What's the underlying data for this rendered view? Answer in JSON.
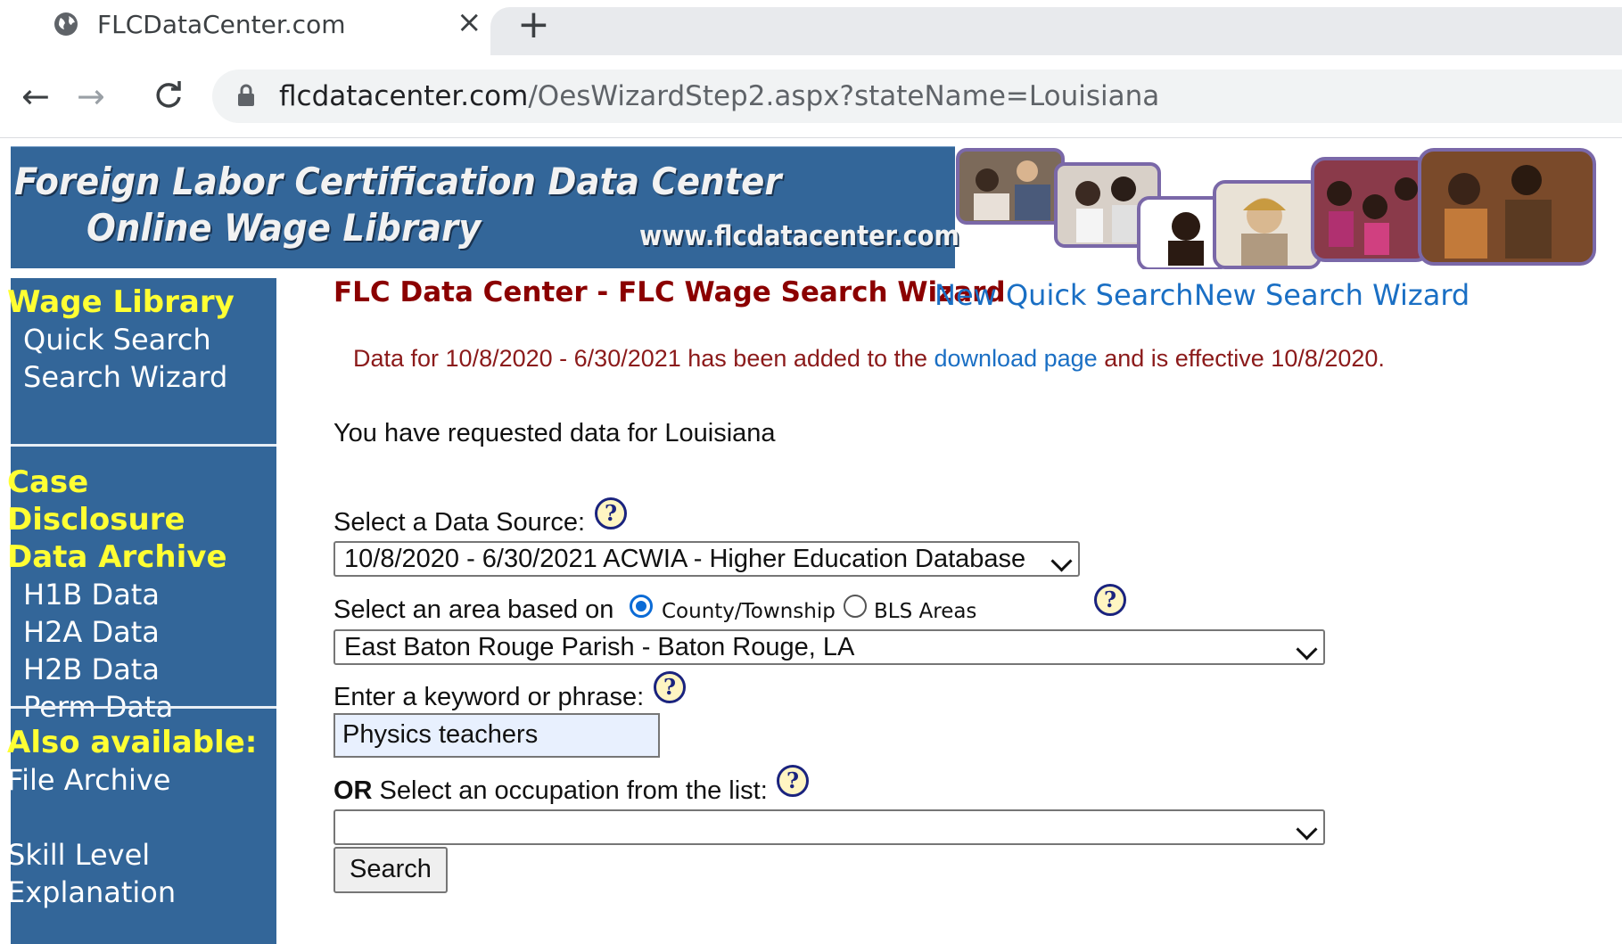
{
  "browser": {
    "tab_title": "FLCDataCenter.com",
    "tab_close": "×",
    "new_tab": "+",
    "back": "←",
    "forward": "→",
    "reload": "C",
    "url_host": "flcdatacenter.com",
    "url_path": "/OesWizardStep2.aspx?stateName=Louisiana"
  },
  "banner": {
    "title_line1": "Foreign Labor Certification Data Center",
    "title_line2": "Online Wage Library",
    "site_url": "www.flcdatacenter.com"
  },
  "sidebar": {
    "wage_library_heading": "Wage Library",
    "quick_search": "Quick Search",
    "search_wizard": "Search Wizard",
    "case_heading_line1": "Case Disclosure",
    "case_heading_line2": "Data Archive",
    "h1b": "H1B Data",
    "h2a": "H2A Data",
    "h2b": "H2B Data",
    "perm": "Perm Data",
    "also_heading": "Also available:",
    "file_archive": "File Archive",
    "skill_line1": "Skill Level",
    "skill_line2": "Explanation"
  },
  "header": {
    "wizard_title": "FLC Data Center - FLC Wage Search Wizard",
    "new_quick_search": "New Quick Search",
    "new_search_wizard": "New Search Wizard"
  },
  "notice": {
    "before": "Data for 10/8/2020 - 6/30/2021 has been added to the ",
    "link": "download page",
    "after": " and is effective 10/8/2020."
  },
  "form": {
    "requested_text": "You have requested data for Louisiana",
    "data_source_label": "Select a Data Source:",
    "data_source_value": "10/8/2020 - 6/30/2021 ACWIA - Higher Education Database",
    "area_label": "Select an area based on",
    "radio_county": "County/Township",
    "radio_bls": "BLS Areas",
    "area_value": "East Baton Rouge Parish - Baton Rouge, LA",
    "keyword_label": "Enter a keyword or phrase:",
    "keyword_value": "Physics teachers",
    "or_bold": "OR",
    "occupation_label": " Select an occupation from the list:",
    "occupation_value": "",
    "search_button": "Search",
    "help_glyph": "?"
  }
}
